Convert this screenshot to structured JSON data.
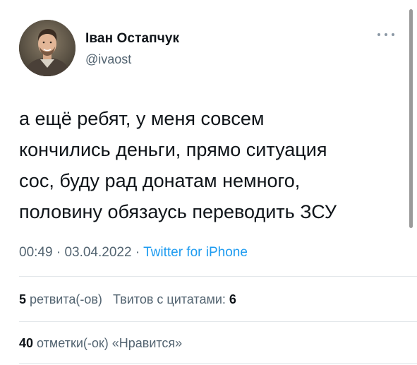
{
  "author": {
    "name": "Іван Остапчук",
    "handle": "@ivaost",
    "avatar_icon": "user-avatar-photo"
  },
  "tweet": {
    "lines": [
      "а ещё ребят, у меня совсем",
      "кончились деньги, прямо ситуация",
      "сос, буду рад донатам немного,",
      "половину обязаусь переводить ЗСУ"
    ],
    "time": "00:49",
    "separator": "·",
    "date": "03.04.2022",
    "source": "Twitter for iPhone"
  },
  "stats": {
    "retweets_count": "5",
    "retweets_label": "ретвита(-ов)",
    "quotes_label": "Твитов с цитатами:",
    "quotes_count": "6",
    "likes_count": "40",
    "likes_label": "отметки(-ок) «Нравится»"
  },
  "colors": {
    "text": "#0f1419",
    "secondary": "#536471",
    "link": "#1d9bf0",
    "divider": "#e3e7ea"
  }
}
